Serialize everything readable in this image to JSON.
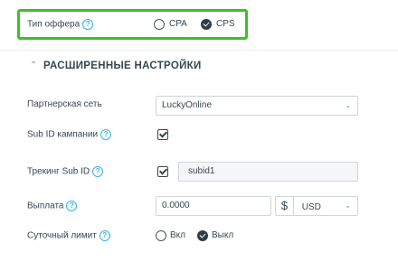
{
  "offer_type": {
    "label": "Тип оффера",
    "options": [
      {
        "label": "CPA",
        "selected": false
      },
      {
        "label": "CPS",
        "selected": true
      }
    ],
    "highlight_color": "#3dbf2a"
  },
  "advanced": {
    "title": "РАСШИРЕННЫЕ НАСТРОЙКИ"
  },
  "partner_network": {
    "label": "Партнерская сеть",
    "value": "LuckyOnline"
  },
  "campaign_sub_id": {
    "label": "Sub ID кампании",
    "checked": true
  },
  "tracking_sub_id": {
    "label": "Трекинг Sub ID",
    "checked": true,
    "value": "subid1"
  },
  "payout": {
    "label": "Выплата",
    "value": "0.0000",
    "currency_symbol": "$",
    "currency": "USD"
  },
  "daily_limit": {
    "label": "Суточный лимит",
    "options": [
      {
        "label": "Вкл",
        "selected": false
      },
      {
        "label": "Выкл",
        "selected": true
      }
    ]
  },
  "help_icon": "?",
  "colors": {
    "accent": "#39b3e3",
    "text": "#3a4650"
  }
}
